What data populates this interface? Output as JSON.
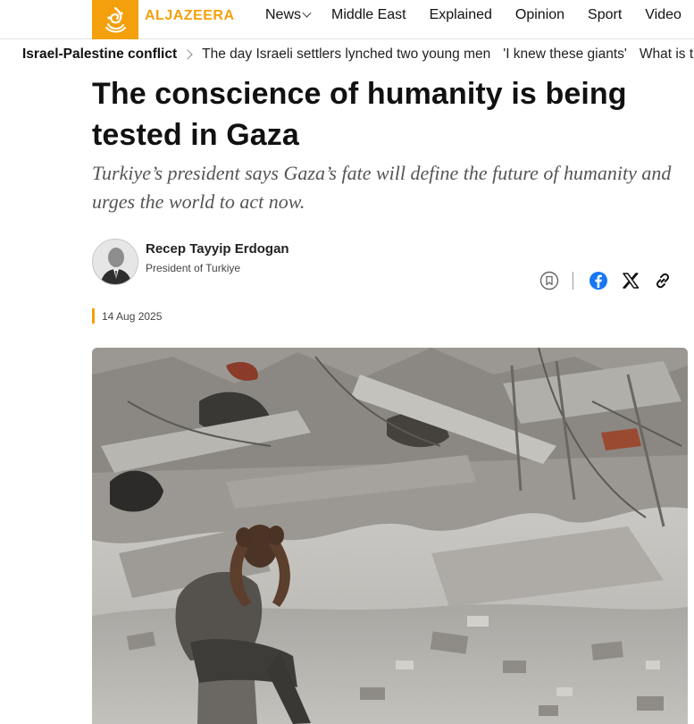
{
  "brand": {
    "logo_text": "ALJAZEERA",
    "accent_color": "#f4a00c"
  },
  "nav": {
    "items": [
      {
        "label": "News",
        "has_dropdown": true
      },
      {
        "label": "Middle East"
      },
      {
        "label": "Explained"
      },
      {
        "label": "Opinion"
      },
      {
        "label": "Sport"
      },
      {
        "label": "Video"
      }
    ]
  },
  "trending": {
    "topic": "Israel-Palestine conflict",
    "links": [
      "The day Israeli settlers lynched two young men",
      "'I knew these giants'",
      "What is the"
    ]
  },
  "article": {
    "headline": "The conscience of humanity is being tested in Gaza",
    "standfirst": "Turkiye’s president says Gaza’s fate will define the future of humanity and urges the world to act now.",
    "author": {
      "name": "Recep Tayyip Erdogan",
      "title": "President of Turkiye"
    },
    "date": "14 Aug 2025",
    "share_icons": [
      "bookmark-icon",
      "facebook-icon",
      "x-icon",
      "link-icon"
    ]
  }
}
